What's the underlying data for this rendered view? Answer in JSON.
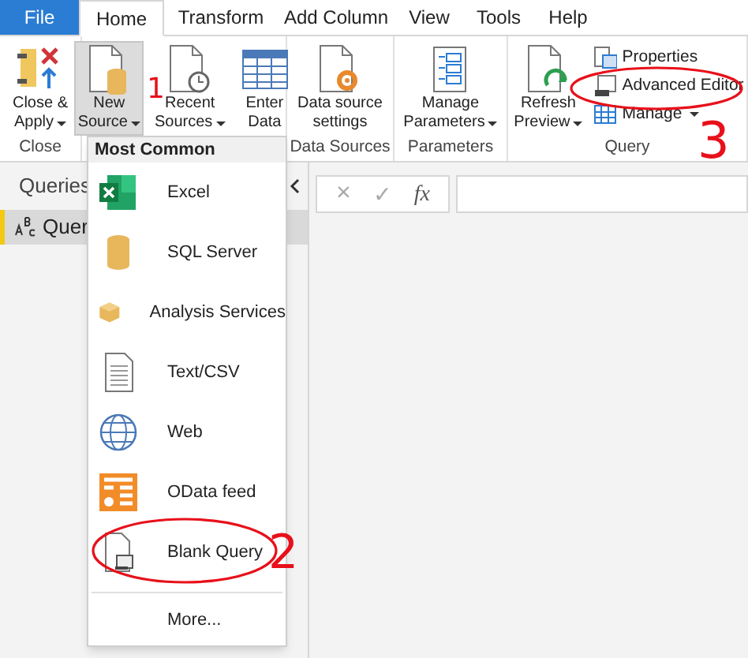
{
  "menu_tabs": [
    {
      "label": "File",
      "kind": "file",
      "selected": false
    },
    {
      "label": "Home",
      "kind": "tab",
      "selected": true
    },
    {
      "label": "Transform",
      "kind": "tab",
      "selected": false
    },
    {
      "label": "Add Column",
      "kind": "tab",
      "selected": false
    },
    {
      "label": "View",
      "kind": "tab",
      "selected": false
    },
    {
      "label": "Tools",
      "kind": "tab",
      "selected": false
    },
    {
      "label": "Help",
      "kind": "tab",
      "selected": false
    }
  ],
  "ribbon_groups": [
    {
      "label": "Close",
      "buttons": [
        {
          "kind": "large",
          "lines": [
            "Close &",
            "Apply"
          ],
          "dropdown": true,
          "pressed": false
        }
      ]
    },
    {
      "buttons": [
        {
          "kind": "large",
          "lines": [
            "New",
            "Source"
          ],
          "dropdown": true,
          "pressed": true
        },
        {
          "kind": "large",
          "lines": [
            "Recent",
            "Sources"
          ],
          "dropdown": true,
          "pressed": false
        },
        {
          "kind": "large",
          "lines": [
            "Enter",
            "Data"
          ],
          "dropdown": false,
          "pressed": false
        }
      ]
    },
    {
      "label": "Data Sources",
      "buttons": [
        {
          "kind": "large",
          "lines": [
            "Data source",
            "settings"
          ],
          "dropdown": false,
          "pressed": false
        }
      ]
    },
    {
      "label": "Parameters",
      "buttons": [
        {
          "kind": "large",
          "lines": [
            "Manage",
            "Parameters"
          ],
          "dropdown": true,
          "pressed": false
        }
      ]
    },
    {
      "label": "Query",
      "buttons": [
        {
          "kind": "large",
          "lines": [
            "Refresh",
            "Preview"
          ],
          "dropdown": true,
          "pressed": false
        },
        {
          "kind": "small",
          "label": "Properties",
          "dropdown": false
        },
        {
          "kind": "small",
          "label": "Advanced Editor",
          "dropdown": false
        },
        {
          "kind": "small",
          "label": "Manage",
          "dropdown": true
        }
      ]
    }
  ],
  "queries_pane": {
    "title": "Queries",
    "items": [
      {
        "label": "Quer",
        "selected": true
      }
    ]
  },
  "formula_bar": {
    "buttons": [
      "×",
      "✓",
      "fx"
    ]
  },
  "new_source_menu": {
    "header": "Most Common",
    "items": [
      {
        "label": "Excel"
      },
      {
        "label": "SQL Server"
      },
      {
        "label": "Analysis Services"
      },
      {
        "label": "Text/CSV"
      },
      {
        "label": "Web"
      },
      {
        "label": "OData feed"
      },
      {
        "label": "Blank Query"
      }
    ],
    "more": "More..."
  },
  "annotations": [
    {
      "text": "1"
    },
    {
      "text": "2"
    },
    {
      "text": "3"
    }
  ]
}
